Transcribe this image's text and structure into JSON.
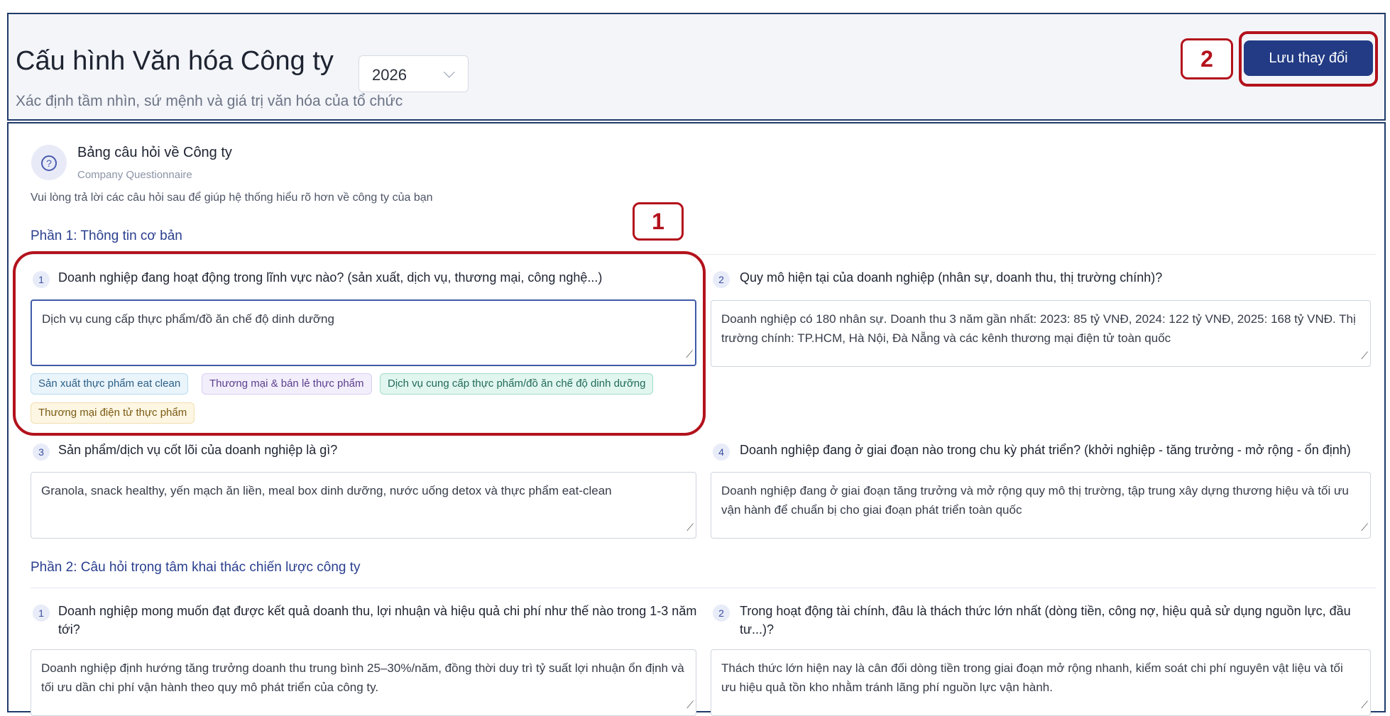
{
  "header": {
    "title": "Cấu hình Văn hóa Công ty",
    "year_select": "2026",
    "subtitle": "Xác định tầm nhìn, sứ mệnh và giá trị văn hóa của tổ chức",
    "save_label": "Lưu thay đổi"
  },
  "annotations": {
    "one": "1",
    "two": "2"
  },
  "card": {
    "icon": "question-circle-icon",
    "title": "Bảng câu hỏi về Công ty",
    "subtitle": "Company Questionnaire",
    "description": "Vui lòng trả lời các câu hỏi sau để giúp hệ thống hiểu rõ hơn về công ty của bạn"
  },
  "section1": {
    "title": "Phần 1: Thông tin cơ bản",
    "questions": [
      {
        "num": "1",
        "text": "Doanh nghiệp đang hoạt động trong lĩnh vực nào? (sản xuất, dịch vụ, thương mại, công nghệ...)",
        "answer": "Dịch vụ cung cấp thực phẩm/đồ ăn chế độ dinh dưỡng",
        "suggestions": [
          "Sản xuất thực phẩm eat clean",
          "Thương mại & bán lẻ thực phẩm",
          "Dịch vụ cung cấp thực phẩm/đồ ăn chế độ dinh dưỡng",
          "Thương mại điện tử thực phẩm"
        ]
      },
      {
        "num": "2",
        "text": "Quy mô hiện tại của doanh nghiệp (nhân sự, doanh thu, thị trường chính)?",
        "answer_a": "Doanh nghiệp có 180 nhân sự. Doanh thu 3 năm gần nhất: 2023: 85 tỷ VNĐ, 2024: 122 tỷ VNĐ, 2025: 168 tỷ",
        "answer_b": "VNĐ. Thị trường chính: TP.HCM, Hà Nội, Đà Nẵng và các kênh thương mại điện tử toàn quốc"
      },
      {
        "num": "3",
        "text": "Sản phẩm/dịch vụ cốt lõi của doanh nghiệp là gì?",
        "answer": "Granola, snack healthy, yến mạch ăn liền, meal box dinh dưỡng, nước uống detox và thực phẩm eat-clean"
      },
      {
        "num": "4",
        "text": "Doanh nghiệp đang ở giai đoạn nào trong chu kỳ phát triển? (khởi nghiệp - tăng trưởng - mở rộng - ổn định)",
        "answer": "Doanh nghiệp đang ở giai đoạn tăng trưởng và mở rộng quy mô thị trường, tập trung xây dựng thương hiệu và tối ưu vận hành để chuẩn bị cho giai đoạn phát triển toàn quốc"
      }
    ]
  },
  "section2": {
    "title": "Phần 2: Câu hỏi trọng tâm khai thác chiến lược công ty",
    "questions": [
      {
        "num": "1",
        "text": "Doanh nghiệp mong muốn đạt được kết quả doanh thu, lợi nhuận và hiệu quả chi phí như thế nào trong 1-3 năm tới?",
        "answer": "Doanh nghiệp định hướng tăng trưởng doanh thu trung bình 25–30%/năm, đồng thời duy trì tỷ suất lợi nhuận ổn định và tối ưu dần chi phí vận hành theo quy mô phát triển của công ty."
      },
      {
        "num": "2",
        "text": "Trong hoạt động tài chính, đâu là thách thức lớn nhất (dòng tiền, công nợ, hiệu quả sử dụng nguồn lực, đầu tư...)?",
        "answer": "Thách thức lớn hiện nay là cân đối dòng tiền trong giai đoạn mở rộng nhanh, kiểm soát chi phí nguyên vật liệu và tối ưu hiệu quả tồn kho nhằm tránh lãng phí nguồn lực vận hành."
      }
    ]
  }
}
